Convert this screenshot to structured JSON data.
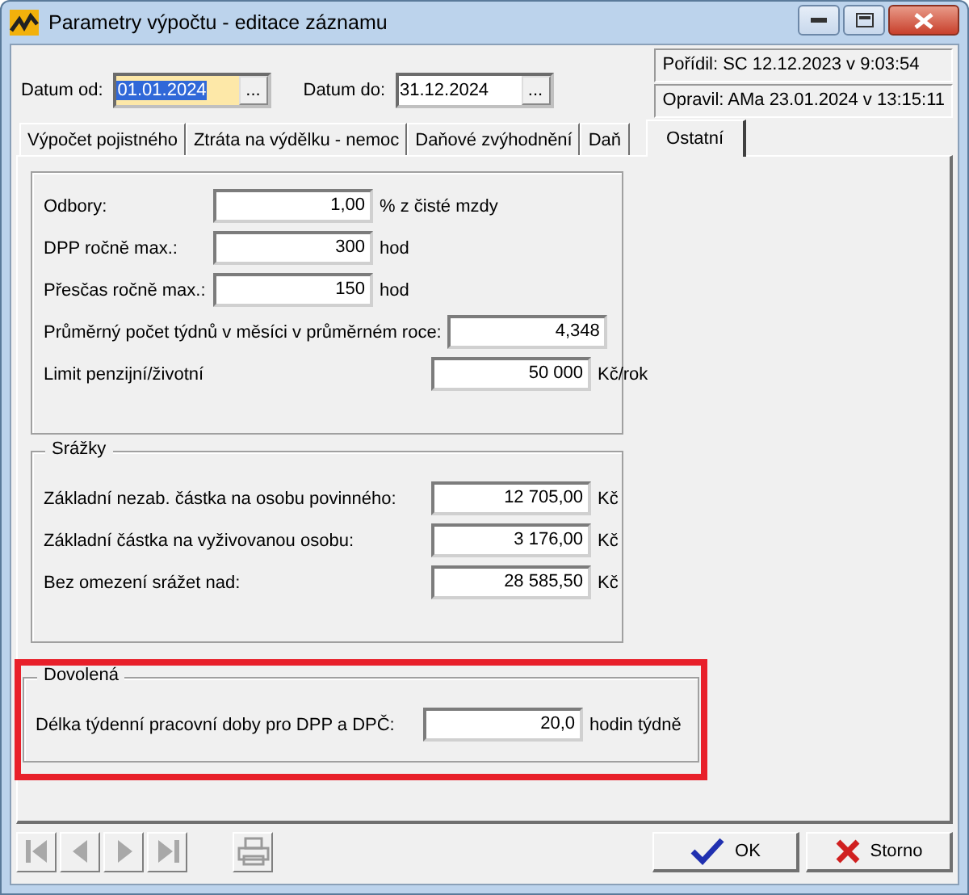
{
  "window": {
    "title": "Parametry výpočtu - editace záznamu"
  },
  "dates": [
    {
      "label": "Datum od:",
      "value": "01.01.2024",
      "focused": true,
      "button": "..."
    },
    {
      "label": "Datum do:",
      "value": "31.12.2024",
      "focused": false,
      "button": "..."
    }
  ],
  "info": [
    "Pořídil: SC 12.12.2023 v 9:03:54",
    "Opravil: AMa 23.01.2024 v 13:15:11"
  ],
  "tabs": [
    {
      "label": "Výpočet pojistného",
      "selected": false
    },
    {
      "label": "Ztráta na výdělku - nemoc",
      "selected": false
    },
    {
      "label": "Daňové zvýhodnění",
      "selected": false
    },
    {
      "label": "Daň",
      "selected": false
    },
    {
      "label": "Ostatní",
      "selected": true
    }
  ],
  "sections": [
    {
      "highlighted": false,
      "rows": [
        {
          "kind": "narrow",
          "label": "Odbory:",
          "value": "1,00",
          "unit": "% z čisté mzdy"
        },
        {
          "kind": "narrow",
          "label": "DPP ročně max.:",
          "value": "300",
          "unit": "hod"
        },
        {
          "kind": "narrow",
          "label": "Přesčas ročně max.:",
          "value": "150",
          "unit": "hod"
        },
        {
          "kind": "wide",
          "label": "Průměrný počet týdnů v měsíci v průměrném roce:",
          "value": "4,348"
        },
        {
          "kind": "wide",
          "label": "Limit penzijní/životní",
          "value": "50 000",
          "unit": "Kč/rok"
        }
      ]
    },
    {
      "title": "Srážky",
      "highlighted": false,
      "rows": [
        {
          "kind": "wide",
          "label": "Základní nezab. částka na osobu povinného:",
          "value": "12 705,00",
          "unit": "Kč"
        },
        {
          "kind": "wide",
          "label": "Základní částka na vyživovanou osobu:",
          "value": "3 176,00",
          "unit": "Kč"
        },
        {
          "kind": "wide",
          "label": "Bez omezení srážet nad:",
          "value": "28 585,50",
          "unit": "Kč"
        }
      ]
    },
    {
      "title": "Dovolená",
      "highlighted": true,
      "rows": [
        {
          "kind": "wide",
          "label": "Délka týdenní pracovní doby pro DPP a DPČ:",
          "value": "20,0",
          "unit": "hodin týdně"
        }
      ]
    }
  ],
  "nav_buttons": [
    {
      "kind": "first",
      "disabled": true
    },
    {
      "kind": "prev",
      "disabled": true
    },
    {
      "kind": "next",
      "disabled": true
    },
    {
      "kind": "last",
      "disabled": true
    }
  ],
  "print_button": {
    "disabled": true
  },
  "buttons": [
    {
      "kind": "ok",
      "label": "OK"
    },
    {
      "kind": "cancel",
      "label": "Storno"
    }
  ]
}
